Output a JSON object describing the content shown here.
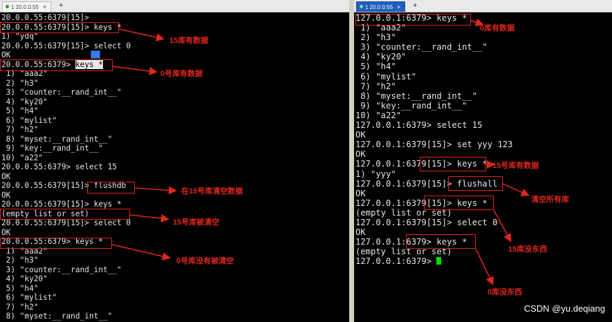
{
  "tabs": {
    "left": {
      "label": "1 20.0.0.55",
      "close": "×",
      "add": "+"
    },
    "right": {
      "label": "1 20.0.0.55",
      "close": "×",
      "add": "+"
    }
  },
  "left_lines": [
    "20.0.0.55:6379[15]>",
    "20.0.0.55:6379[15]> keys *",
    "1) \"ydq\"",
    "20.0.0.55:6379[15]> select 0",
    "OK",
    "20.0.0.55:6379> keys *",
    " 1) \"aaa2\"",
    " 2) \"h3\"",
    " 3) \"counter:__rand_int__\"",
    " 4) \"ky20\"",
    " 5) \"h4\"",
    " 6) \"mylist\"",
    " 7) \"h2\"",
    " 8) \"myset:__rand_int__\"",
    " 9) \"key:__rand_int__\"",
    "10) \"a22\"",
    "20.0.0.55:6379> select 15",
    "OK",
    "20.0.0.55:6379[15]> flushdb",
    "OK",
    "20.0.0.55:6379[15]> keys *",
    "(empty list or set)",
    "20.0.0.55:6379[15]> select 0",
    "OK",
    "20.0.0.55:6379> keys *",
    " 1) \"aaa2\"",
    " 2) \"h3\"",
    " 3) \"counter:__rand_int__\"",
    " 4) \"ky20\"",
    " 5) \"h4\"",
    " 6) \"mylist\"",
    " 7) \"h2\"",
    " 8) \"myset:__rand_int__\""
  ],
  "right_lines": [
    "127.0.0.1:6379> keys *",
    " 1) \"aaa2\"",
    " 2) \"h3\"",
    " 3) \"counter:__rand_int__\"",
    " 4) \"ky20\"",
    " 5) \"h4\"",
    " 6) \"mylist\"",
    " 7) \"h2\"",
    " 8) \"myset:__rand_int__\"",
    " 9) \"key:__rand_int__\"",
    "10) \"a22\"",
    "127.0.0.1:6379> select 15",
    "OK",
    "127.0.0.1:6379[15]> set yyy 123",
    "OK",
    "127.0.0.1:6379[15]> keys *",
    "1) \"yyy\"",
    "127.0.0.1:6379[15]> flushall",
    "OK",
    "127.0.0.1:6379[15]> keys *",
    "(empty list or set)",
    "127.0.0.1:6379[15]> select 0",
    "OK",
    "127.0.0.1:6379> keys *",
    "(empty list or set)",
    "127.0.0.1:6379> "
  ],
  "notes": {
    "l1": "15库有数据",
    "l2": "0号库有数据",
    "l3": "在15号库清空数据",
    "l4": "15号库被清空",
    "l5": "0号库没有被清空",
    "r1": "0库有数据",
    "r2": "15号库有数据",
    "r3": "清空所有库",
    "r4": "15库没东西",
    "r5": "0库没东西"
  },
  "watermark": "CSDN @yu.deqiang",
  "colors": {
    "annotation": "#e0261d",
    "cursor": "#00e000",
    "terminal_bg": "#000000"
  }
}
